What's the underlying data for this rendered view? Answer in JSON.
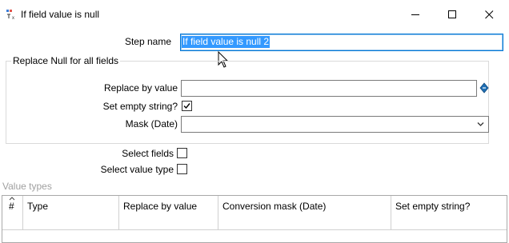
{
  "window": {
    "title": "If field value is null",
    "minimize_glyph": "—",
    "maximize_glyph": "☐",
    "close_glyph": "✕"
  },
  "step": {
    "label": "Step name",
    "value": "If field value is null 2"
  },
  "replace_null_group": {
    "legend": "Replace Null for all fields",
    "replace_by_value_label": "Replace by value",
    "replace_by_value": "",
    "set_empty_string_label": "Set empty string?",
    "set_empty_string_checked": true,
    "mask_label": "Mask (Date)",
    "mask_value": ""
  },
  "select_fields": {
    "label": "Select fields",
    "checked": false
  },
  "select_value_type": {
    "label": "Select value type",
    "checked": false
  },
  "value_types": {
    "label": "Value types",
    "columns": [
      "#",
      "Type",
      "Replace by value",
      "Conversion mask (Date)",
      "Set empty string?"
    ]
  },
  "icons": {
    "title": "if-null-step-icon",
    "variable": "variable-diamond-icon",
    "dropdown": "chevron-down-icon",
    "sort": "sort-up-icon"
  },
  "colors": {
    "selection": "#3399ff",
    "focus_border": "#0078d7"
  }
}
